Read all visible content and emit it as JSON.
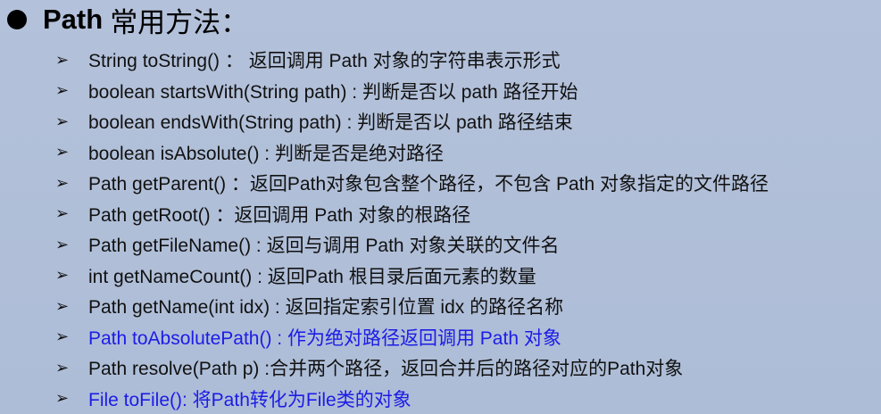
{
  "title": {
    "bold": "Path",
    "rest": "常用方法："
  },
  "colors": {
    "blue": "#1c1ce6",
    "text": "#111111"
  },
  "items": [
    {
      "text": "String toString() ： 返回调用 Path 对象的字符串表示形式",
      "blue": false
    },
    {
      "text": "boolean startsWith(String path) : 判断是否以 path 路径开始",
      "blue": false
    },
    {
      "text": "boolean endsWith(String path) : 判断是否以 path 路径结束",
      "blue": false
    },
    {
      "text": "boolean isAbsolute() : 判断是否是绝对路径",
      "blue": false
    },
    {
      "text": "Path getParent() ：返回Path对象包含整个路径，不包含 Path 对象指定的文件路径",
      "blue": false
    },
    {
      "text": "Path getRoot() ：返回调用 Path 对象的根路径",
      "blue": false
    },
    {
      "text": "Path getFileName() : 返回与调用 Path 对象关联的文件名",
      "blue": false
    },
    {
      "text": "int getNameCount() : 返回Path 根目录后面元素的数量",
      "blue": false
    },
    {
      "text": "Path getName(int idx) : 返回指定索引位置 idx 的路径名称",
      "blue": false
    },
    {
      "text": "Path toAbsolutePath() : 作为绝对路径返回调用 Path 对象",
      "blue": true
    },
    {
      "text": "Path resolve(Path p) :合并两个路径，返回合并后的路径对应的Path对象",
      "blue": false
    },
    {
      "text": "File toFile(): 将Path转化为File类的对象",
      "blue": true
    }
  ]
}
